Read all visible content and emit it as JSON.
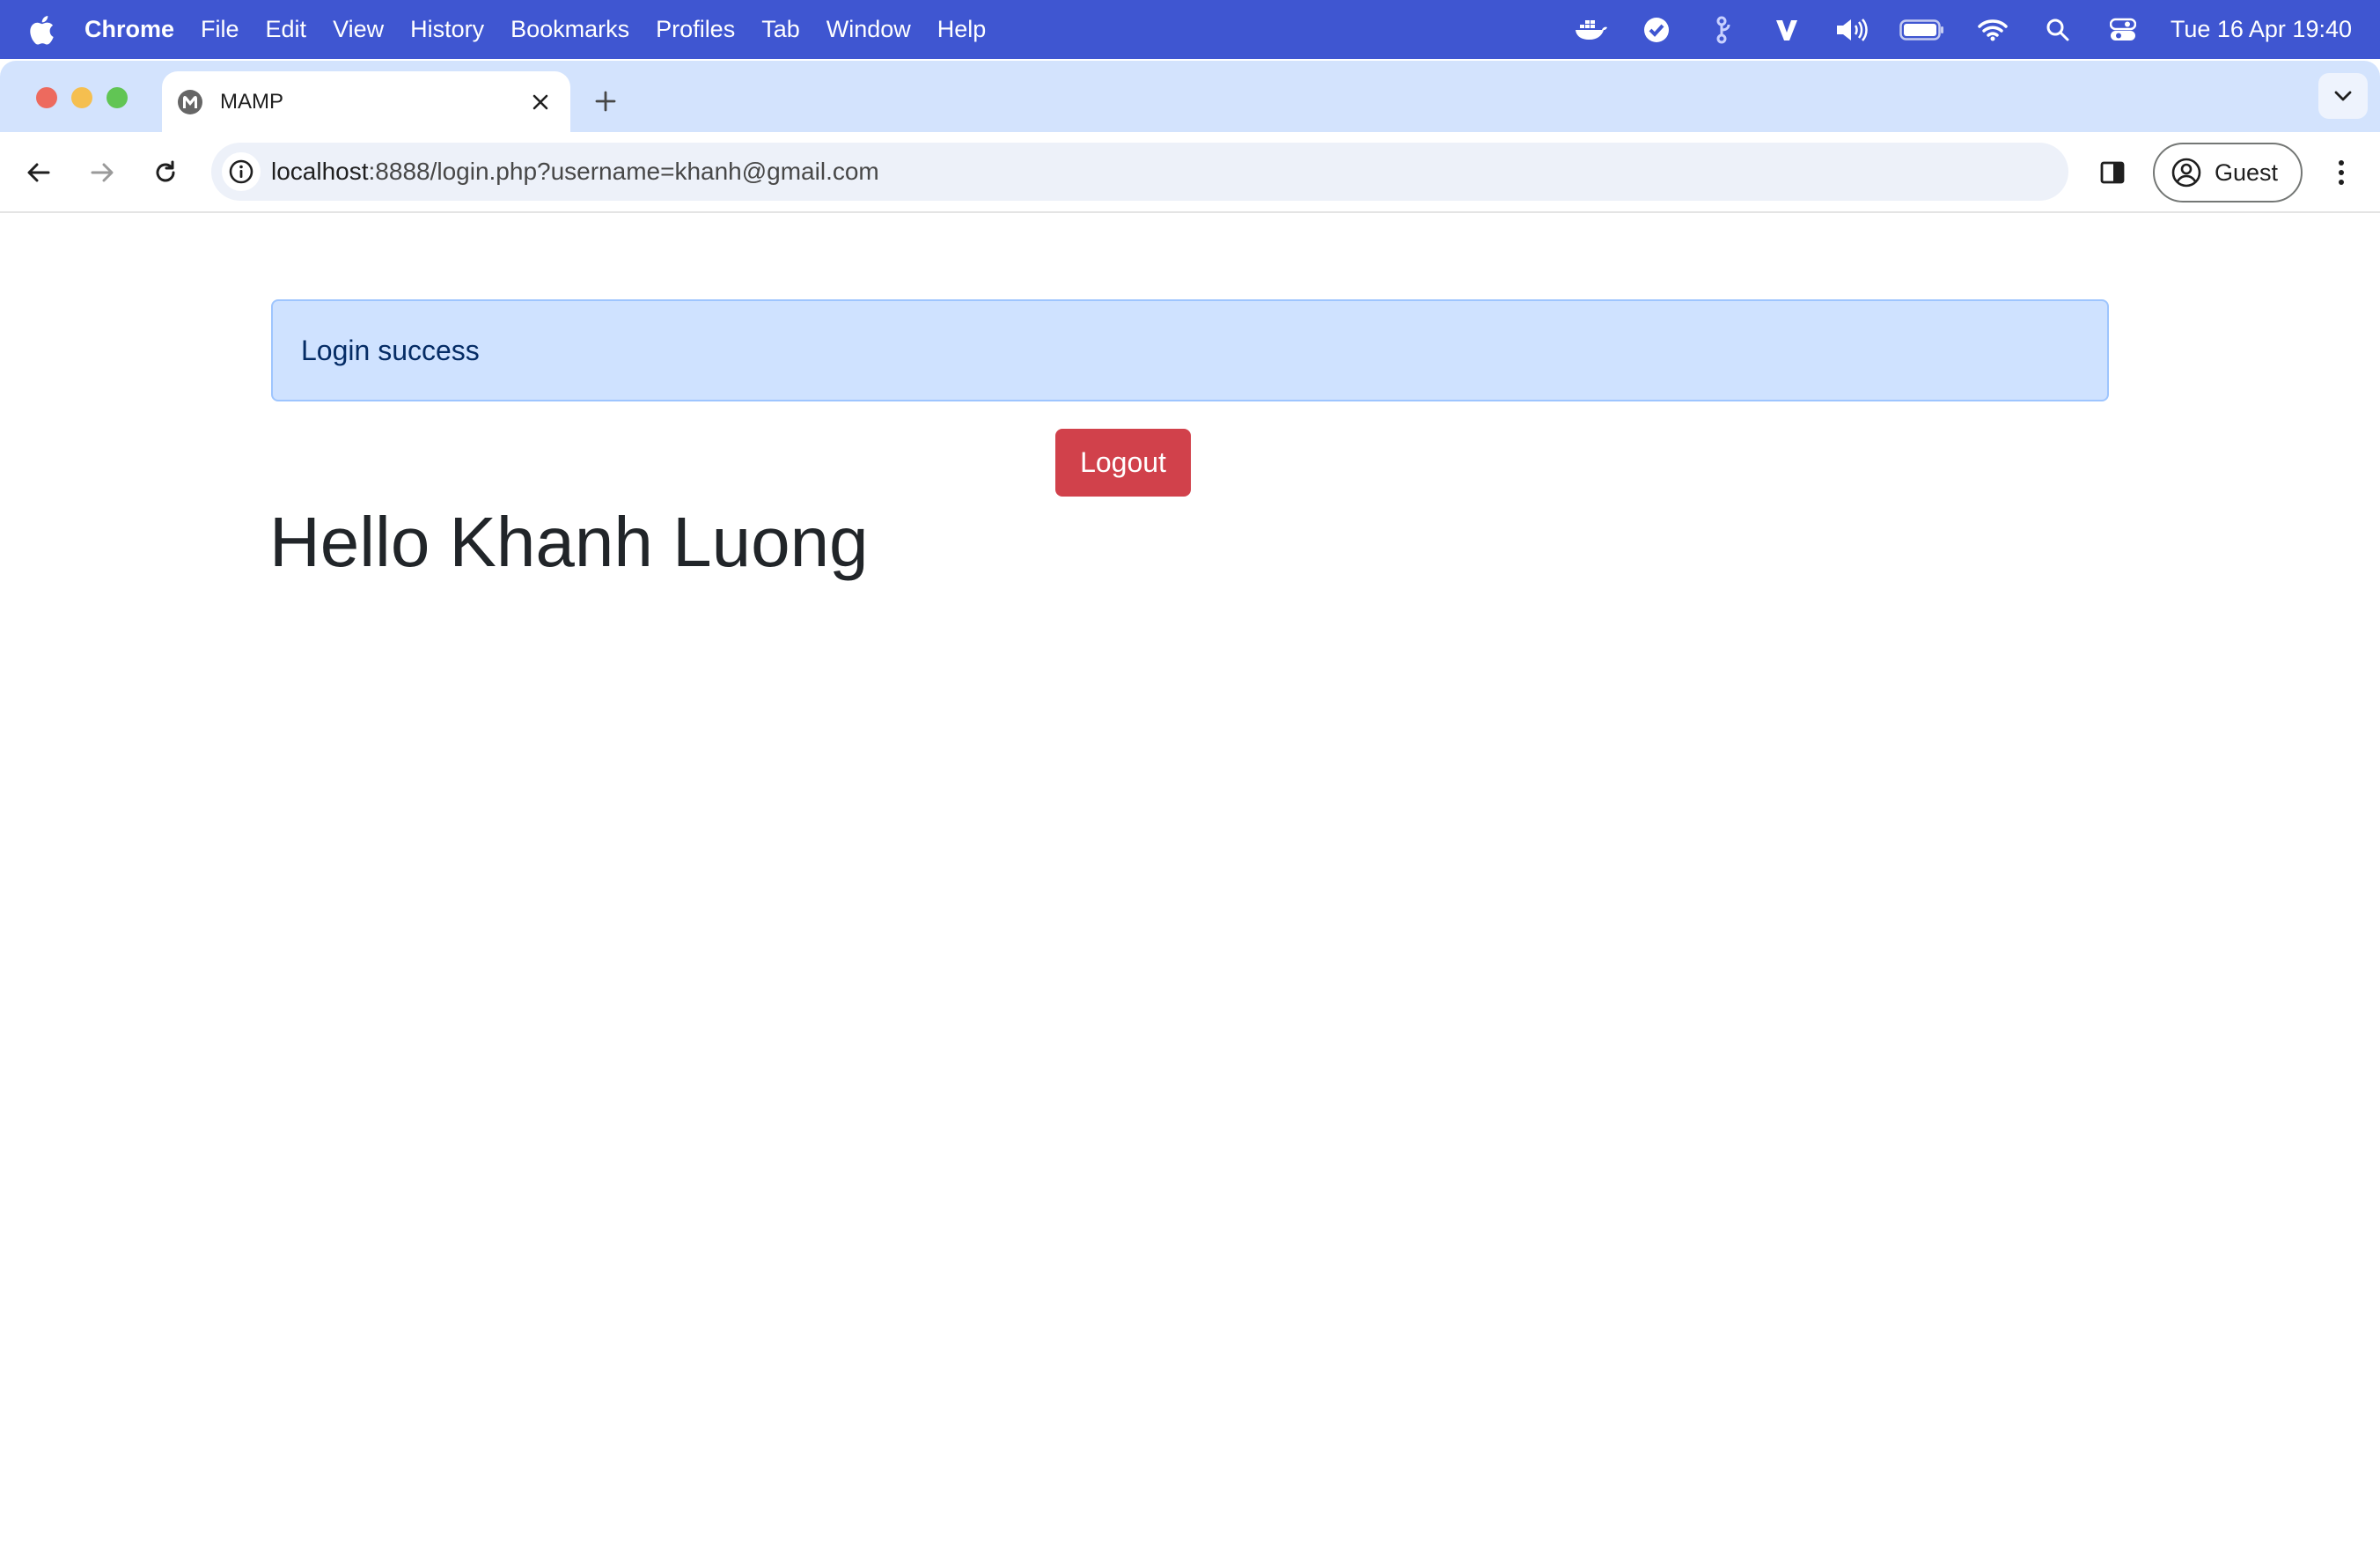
{
  "menubar": {
    "app_name": "Chrome",
    "items": [
      "File",
      "Edit",
      "View",
      "History",
      "Bookmarks",
      "Profiles",
      "Tab",
      "Window",
      "Help"
    ],
    "status_icons": [
      "docker-icon",
      "checkmark-circle-icon",
      "git-icon",
      "v-icon",
      "volume-icon",
      "battery-icon",
      "wifi-icon",
      "spotlight-search-icon",
      "control-center-icon"
    ],
    "clock": "Tue 16 Apr  19:40",
    "color": "#3f56d1"
  },
  "browser": {
    "tab": {
      "title": "MAMP"
    },
    "address_bar": {
      "host": "localhost",
      "path": ":8888/login.php?username=khanh@gmail.com"
    },
    "profile": {
      "label": "Guest"
    }
  },
  "page": {
    "alert": {
      "text": "Login success",
      "background": "#cfe2ff"
    },
    "logout_button": {
      "label": "Logout",
      "color": "#d1414b"
    },
    "greeting": "Hello Khanh Luong"
  }
}
